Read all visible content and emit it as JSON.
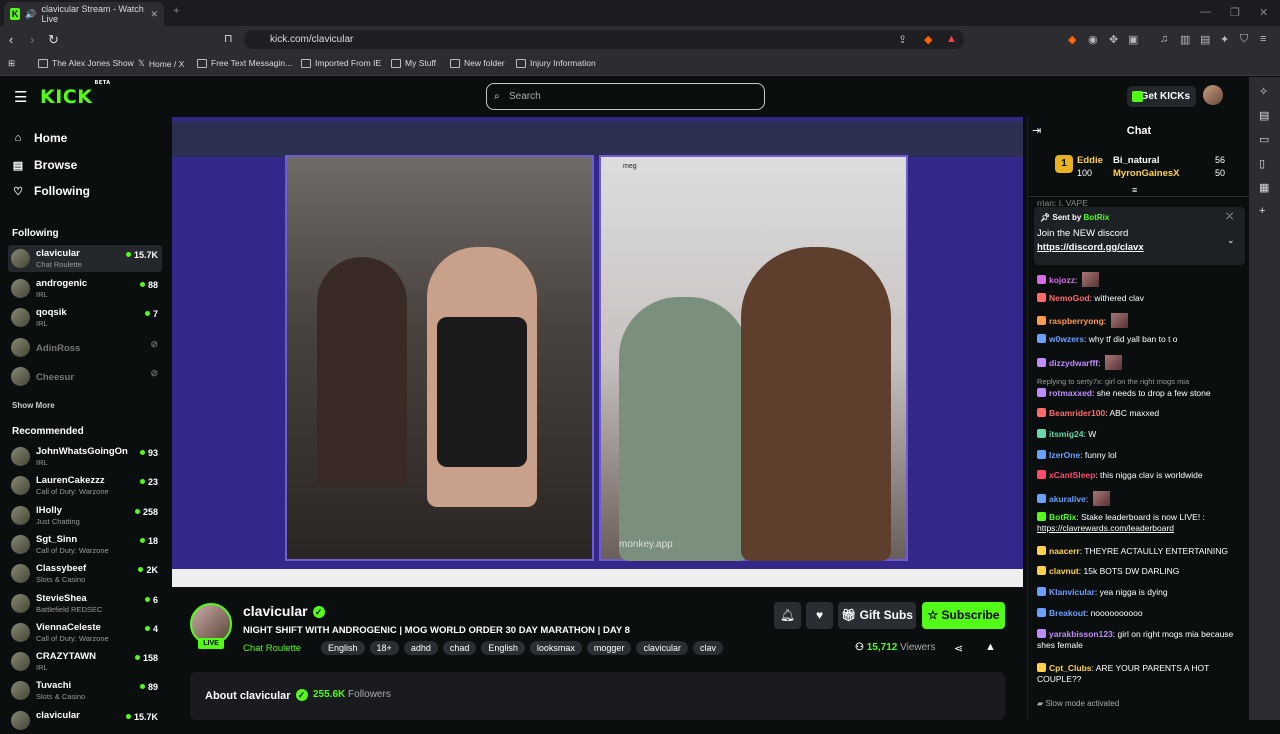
{
  "browser": {
    "tab_title": "clavicular Stream - Watch Live",
    "url": "kick.com/clavicular",
    "bookmarks": [
      "The Alex Jones Show",
      "Home / X",
      "Free Text Messagin...",
      "Imported From IE",
      "My Stuff",
      "New folder",
      "Injury Information"
    ]
  },
  "header": {
    "logo": "KICK",
    "logo_sup": "BETA",
    "search_placeholder": "Search",
    "get_kicks": "Get KICKs"
  },
  "sidebar": {
    "nav": [
      {
        "label": "Home",
        "icon": "home-icon"
      },
      {
        "label": "Browse",
        "icon": "browse-icon"
      },
      {
        "label": "Following",
        "icon": "heart-icon"
      }
    ],
    "following_heading": "Following",
    "following": [
      {
        "name": "clavicular",
        "category": "Chat Roulette",
        "viewers": "15.7K",
        "live": true
      },
      {
        "name": "androgenic",
        "category": "IRL",
        "viewers": "88",
        "live": true
      },
      {
        "name": "qoqsik",
        "category": "IRL",
        "viewers": "7",
        "live": true
      },
      {
        "name": "AdinRoss",
        "category": "",
        "viewers": "",
        "live": false
      },
      {
        "name": "Cheesur",
        "category": "",
        "viewers": "",
        "live": false
      }
    ],
    "show_more": "Show More",
    "recommended_heading": "Recommended",
    "recommended": [
      {
        "name": "JohnWhatsGoingOn",
        "category": "IRL",
        "viewers": "93"
      },
      {
        "name": "LaurenCakezzz",
        "category": "Call of Duty: Warzone",
        "viewers": "23"
      },
      {
        "name": "lHolly",
        "category": "Just Chatting",
        "viewers": "258"
      },
      {
        "name": "Sgt_Sinn",
        "category": "Call of Duty: Warzone",
        "viewers": "18"
      },
      {
        "name": "Classybeef",
        "category": "Slots & Casino",
        "viewers": "2K"
      },
      {
        "name": "StevieShea",
        "category": "Battlefield REDSEC",
        "viewers": "6"
      },
      {
        "name": "ViennaCeleste",
        "category": "Call of Duty: Warzone",
        "viewers": "4"
      },
      {
        "name": "CRAZYTAWN",
        "category": "IRL",
        "viewers": "158"
      },
      {
        "name": "Tuvachi",
        "category": "Slots & Casino",
        "viewers": "89"
      },
      {
        "name": "clavicular",
        "category": "",
        "viewers": "15.7K"
      }
    ]
  },
  "video": {
    "watermark": "monkey.app",
    "right_name": "meg"
  },
  "channel": {
    "name": "clavicular",
    "live": "LIVE",
    "title": "NIGHT SHIFT WITH ANDROGENIC | MOG WORLD ORDER 30 DAY MARATHON | DAY 8",
    "category": "Chat Roulette",
    "tags": [
      "English",
      "18+",
      "adhd",
      "chad",
      "English",
      "looksmax",
      "mogger",
      "clavicular",
      "clav"
    ],
    "gift_subs": "Gift Subs",
    "subscribe": "Subscribe",
    "viewers": "15,712",
    "viewers_label": "Viewers",
    "about_title": "About clavicular",
    "followers": "255.6K",
    "followers_label": "Followers"
  },
  "chat": {
    "heading": "Chat",
    "leaderboard": [
      {
        "name": "Eddie",
        "value": "100"
      },
      {
        "name": "Bi_natural",
        "value": "56"
      },
      {
        "name": "MyronGainesX",
        "value": "50"
      }
    ],
    "partial_top": "rrian: I. VAPE",
    "pinned": {
      "sent_by_label": "Sent by",
      "sender": "BotRix",
      "text": "Join the NEW discord",
      "link": "https://discord.gg/clavx"
    },
    "messages": [
      {
        "user": "kojozz",
        "color": "#d66be6",
        "text": ""
      },
      {
        "user": "NemoGod",
        "color": "#ff6b6b",
        "text": "withered clav"
      },
      {
        "user": "raspberryong",
        "color": "#ff9b4b",
        "text": ""
      },
      {
        "user": "w0wzers",
        "color": "#6ba0ff",
        "text": "why tf did yall ban to t o"
      },
      {
        "user": "dizzydwarfff",
        "color": "#c08bff",
        "text": ""
      },
      {
        "user": "rotmaxxed",
        "color": "#c08bff",
        "text": "she needs to drop a few stone",
        "reply": "Replying to serty7x: girl on the right mogs mia"
      },
      {
        "user": "Beamrider100",
        "color": "#ff6b6b",
        "text": "ABC maxxed"
      },
      {
        "user": "itsmig24",
        "color": "#6bd6a8",
        "text": "W"
      },
      {
        "user": "IzerOne",
        "color": "#6ba0ff",
        "text": "funny lol"
      },
      {
        "user": "xCantSleep",
        "color": "#ff4b6b",
        "text": "this nigga clav is worldwide"
      },
      {
        "user": "akuralive",
        "color": "#6ba0ff",
        "text": ""
      },
      {
        "user": "BotRix",
        "color": "#53fc18",
        "text": "Stake leaderboard is now LIVE! :",
        "link": "https://clavrewards.com/leaderboard"
      },
      {
        "user": "naacerr",
        "color": "#ffd24b",
        "text": "THEYRE ACTAULLY ENTERTAINING"
      },
      {
        "user": "clavnut",
        "color": "#ffd24b",
        "text": "15k BOTS DW DARLING"
      },
      {
        "user": "Klanvicular",
        "color": "#6ba0ff",
        "text": "yea nigga is dying"
      },
      {
        "user": "Breakout",
        "color": "#6ba0ff",
        "text": "noooooooooo"
      },
      {
        "user": "yarakbisson123",
        "color": "#c08bff",
        "text": "girl on right mogs mia because shes female"
      },
      {
        "user": "Cpt_Clubs",
        "color": "#ffd24b",
        "text": "ARE YOUR PARENTS A HOT COUPLE??"
      }
    ],
    "slow_mode": "Slow mode activated"
  }
}
